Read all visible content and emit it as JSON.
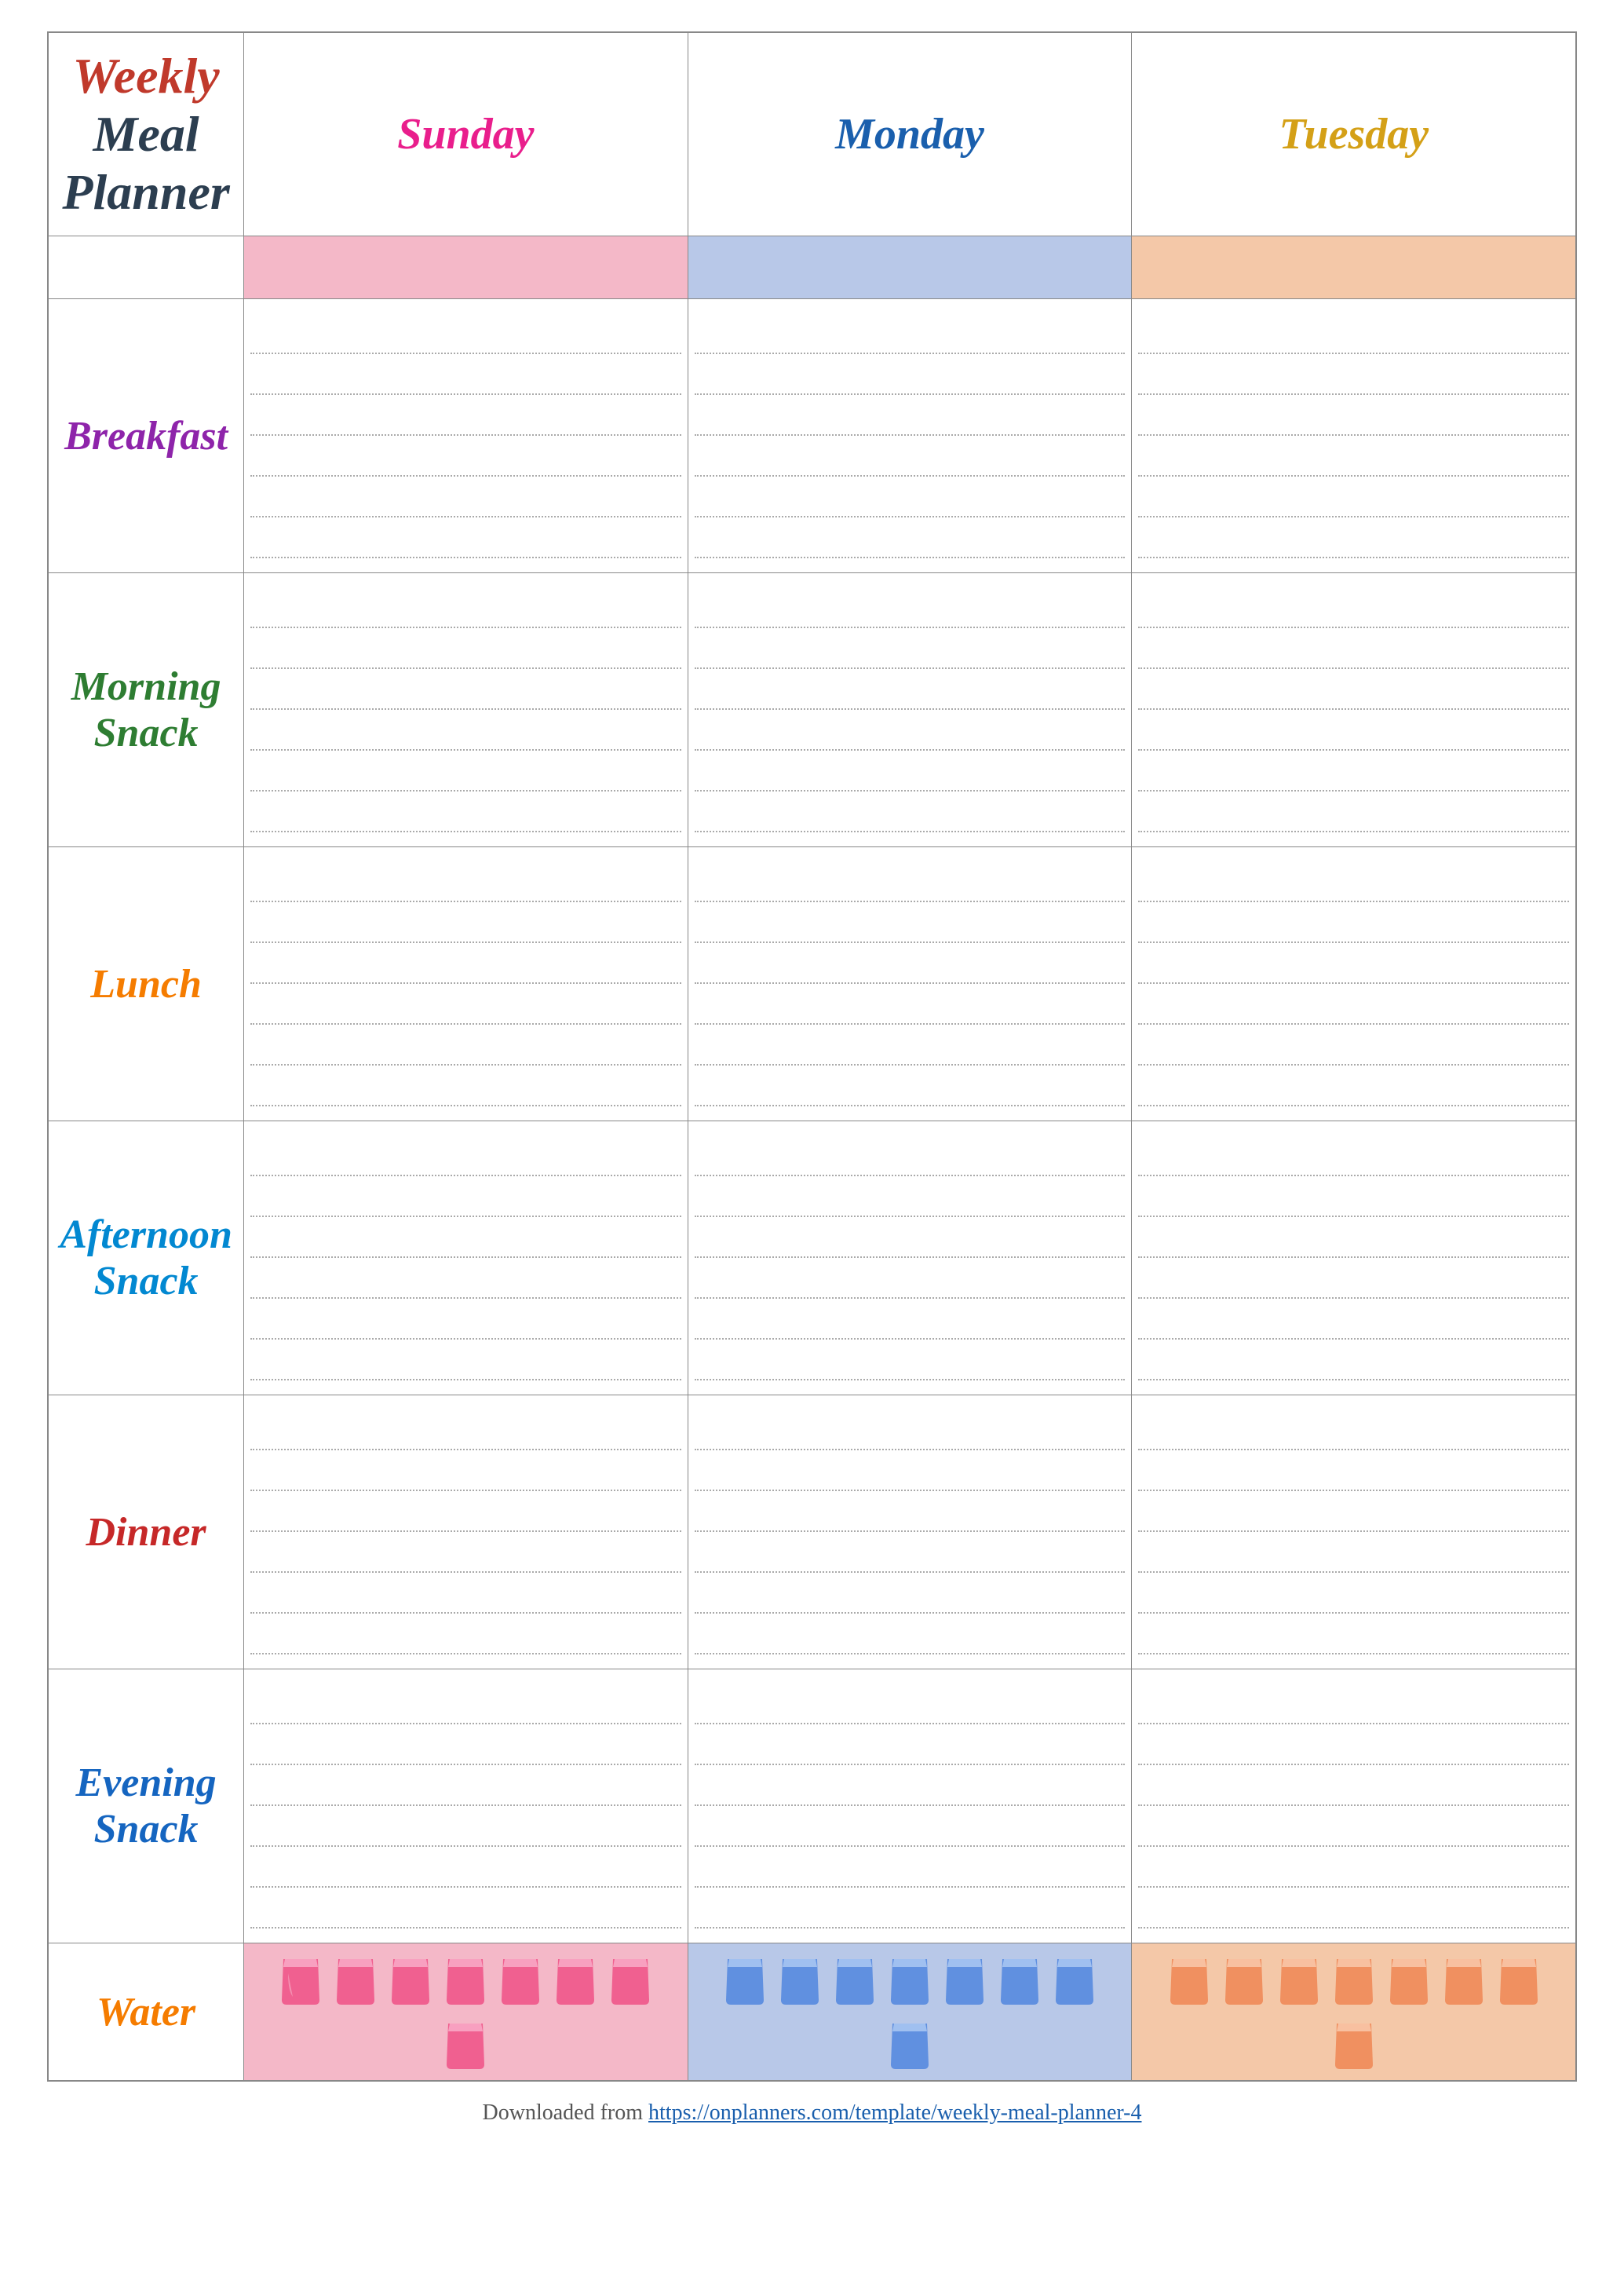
{
  "title": {
    "line1": "Weekly",
    "line2": "Meal Planner"
  },
  "days": [
    {
      "name": "Sunday",
      "color_class": "day-sunday",
      "bg_class": "color-sunday",
      "water_bg": "water-bg-sunday",
      "cup_class": "cup-sunday"
    },
    {
      "name": "Monday",
      "color_class": "day-monday",
      "bg_class": "color-monday",
      "water_bg": "water-bg-monday",
      "cup_class": "cup-monday"
    },
    {
      "name": "Tuesday",
      "color_class": "day-tuesday",
      "bg_class": "color-tuesday",
      "water_bg": "water-bg-tuesday",
      "cup_class": "cup-tuesday"
    }
  ],
  "meals": [
    {
      "label": "Breakfast",
      "color_class": "breakfast-label",
      "lines": 6
    },
    {
      "label": "Morning Snack",
      "color_class": "morning-snack-label",
      "lines": 6,
      "two_line": true
    },
    {
      "label": "Lunch",
      "color_class": "lunch-label",
      "lines": 6
    },
    {
      "label": "Afternoon Snack",
      "color_class": "afternoon-snack-label",
      "lines": 6,
      "two_line": true
    },
    {
      "label": "Dinner",
      "color_class": "dinner-label",
      "lines": 6
    },
    {
      "label": "Evening Snack",
      "color_class": "evening-snack-label",
      "lines": 6,
      "two_line": true
    }
  ],
  "water": {
    "label": "Water",
    "cups_count": 8
  },
  "footer": {
    "text": "Downloaded from ",
    "link_text": "https://onplanners.com/template/weekly-meal-planner-4",
    "link_url": "https://onplanners.com/template/weekly-meal-planner-4"
  }
}
